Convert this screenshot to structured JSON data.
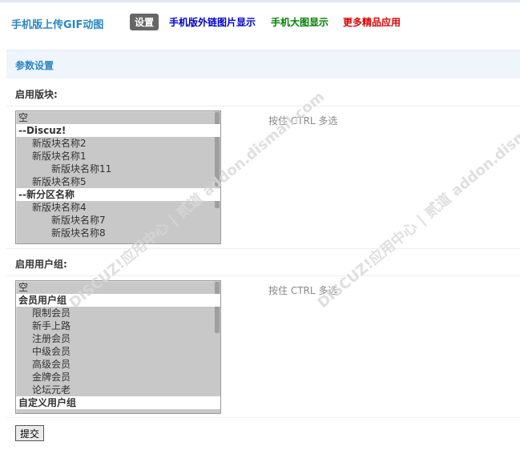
{
  "header": {
    "plugin_title": "手机版上传GIF动图",
    "tabs": [
      {
        "label": "设置",
        "active": true
      },
      {
        "label": "手机版外链图片显示",
        "color": "#0000cc"
      },
      {
        "label": "手机大图显示",
        "color": "#008000"
      },
      {
        "label": "更多精品应用",
        "color": "#dd0000"
      }
    ]
  },
  "section": {
    "title": "参数设置"
  },
  "forums": {
    "label": "启用版块:",
    "hint": "按住 CTRL 多选",
    "options": [
      {
        "text": "空",
        "level": 0
      },
      {
        "text": "--Discuz!",
        "level": 0,
        "group": true
      },
      {
        "text": "新版块名称2",
        "level": 1
      },
      {
        "text": "新版块名称1",
        "level": 1
      },
      {
        "text": "新版块名称11",
        "level": 2
      },
      {
        "text": "新版块名称5",
        "level": 1
      },
      {
        "text": "--新分区名称",
        "level": 0,
        "group": true
      },
      {
        "text": "新版块名称4",
        "level": 1
      },
      {
        "text": "新版块名称7",
        "level": 2
      },
      {
        "text": "新版块名称8",
        "level": 2
      }
    ]
  },
  "usergroups": {
    "label": "启用用户组:",
    "hint": "按住 CTRL 多选",
    "options": [
      {
        "text": "空",
        "level": 0
      },
      {
        "text": "会员用户组",
        "level": 0,
        "group": true
      },
      {
        "text": "限制会员",
        "level": 1
      },
      {
        "text": "新手上路",
        "level": 1
      },
      {
        "text": "注册会员",
        "level": 1
      },
      {
        "text": "中级会员",
        "level": 1
      },
      {
        "text": "高级会员",
        "level": 1
      },
      {
        "text": "金牌会员",
        "level": 1
      },
      {
        "text": "论坛元老",
        "level": 1
      },
      {
        "text": "自定义用户组",
        "level": 0,
        "group": true
      }
    ]
  },
  "submit_label": "提交",
  "watermark": "DISCUZ!应用中心 | 贰道  addon.dismall.com"
}
